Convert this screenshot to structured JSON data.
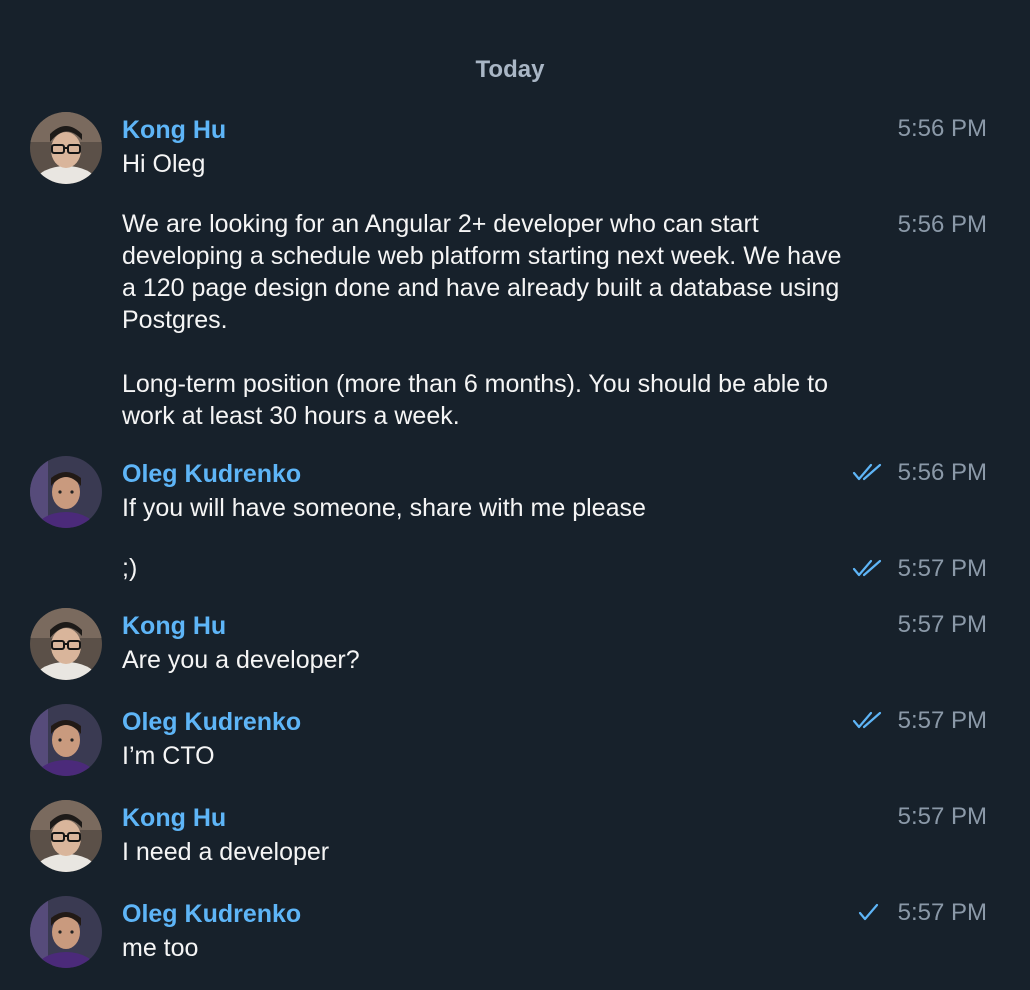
{
  "date_separator": "Today",
  "accent_color": "#5eb5f7",
  "background_color": "#17212b",
  "participants": {
    "kong": {
      "name": "Kong Hu",
      "avatar_icon": "kong-hu-avatar"
    },
    "oleg": {
      "name": "Oleg Kudrenko",
      "avatar_icon": "oleg-kudrenko-avatar"
    }
  },
  "messages": [
    {
      "author": "Kong Hu",
      "text": "Hi Oleg",
      "time": "5:56 PM",
      "status": "none"
    },
    {
      "author": "",
      "text": "We are looking for an Angular 2+ developer who can start developing a schedule web platform starting next week. We have a 120 page design done and have already built a database using Postgres.\n\nLong-term position (more than 6 months). You should be able to work at least 30 hours a week.",
      "time": "5:56 PM",
      "status": "none"
    },
    {
      "author": "Oleg Kudrenko",
      "text": "If you will have someone, share with me please",
      "time": "5:56 PM",
      "status": "read"
    },
    {
      "author": "",
      "text": ";)",
      "time": "5:57 PM",
      "status": "read"
    },
    {
      "author": "Kong Hu",
      "text": "Are you a developer?",
      "time": "5:57 PM",
      "status": "none"
    },
    {
      "author": "Oleg Kudrenko",
      "text": "I’m CTO",
      "time": "5:57 PM",
      "status": "read"
    },
    {
      "author": "Kong Hu",
      "text": "I need a developer",
      "time": "5:57 PM",
      "status": "none"
    },
    {
      "author": "Oleg Kudrenko",
      "text": "me too",
      "time": "5:57 PM",
      "status": "sent"
    }
  ]
}
